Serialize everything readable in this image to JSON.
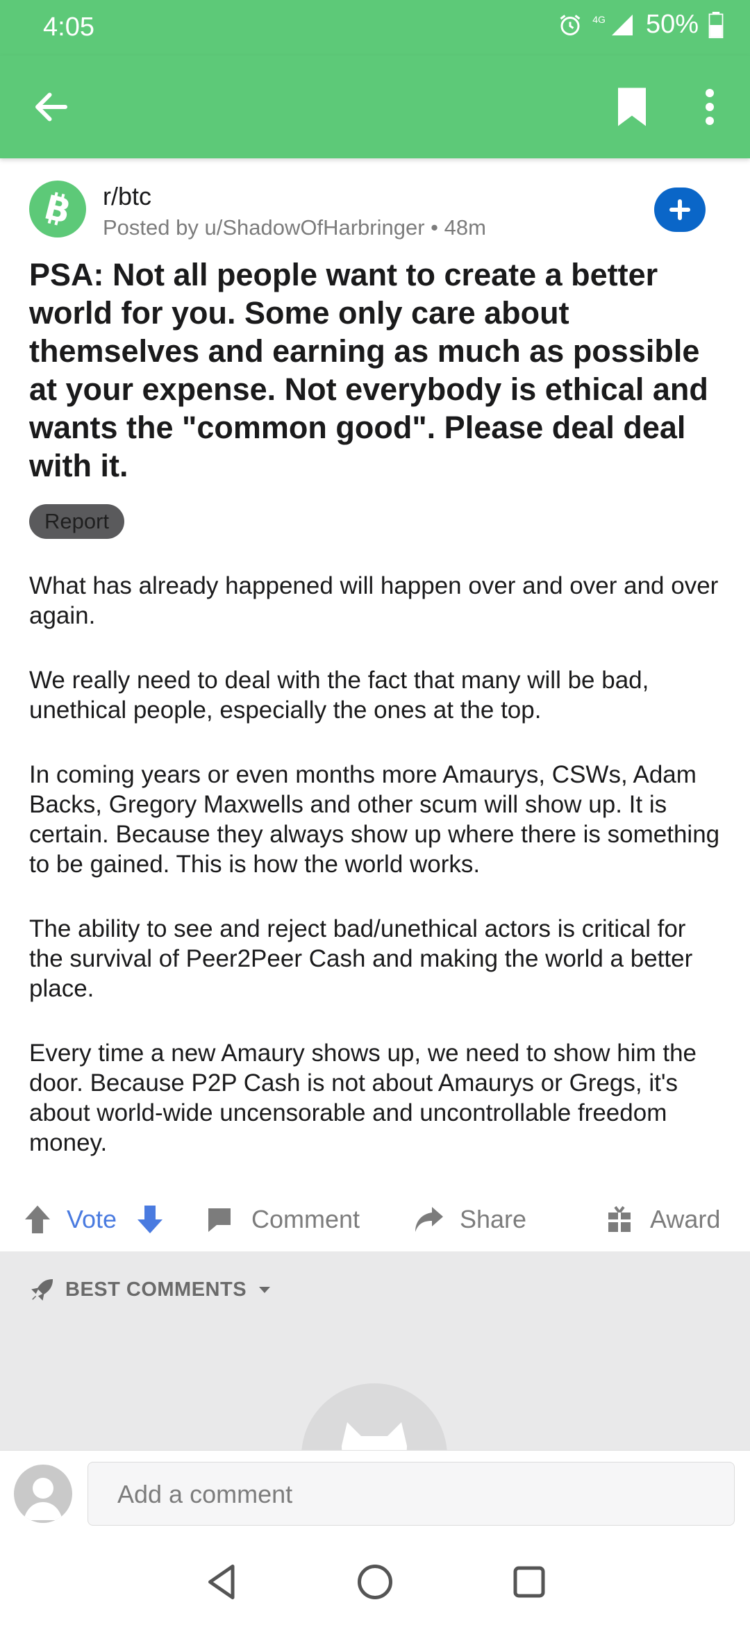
{
  "status": {
    "time": "4:05",
    "network": "4G",
    "battery": "50%"
  },
  "appbar": {
    "back_icon": "arrow-left-icon",
    "bookmark_icon": "bookmark-icon",
    "more_icon": "more-vert-icon"
  },
  "post": {
    "subreddit": "r/btc",
    "meta": "Posted by u/ShadowOfHarbringer • 48m",
    "title": "PSA: Not all people want to create a better world for you. Some only care about themselves and earning as much as possible at your expense. Not everybody is ethical and wants the \"common good\". Please deal deal with it.",
    "flair": "Report",
    "paragraphs": [
      "What has already happened will happen over and over and over again.",
      "We really need to deal with the fact that many will be bad, unethical people, especially the ones at the top.",
      "In coming years or even months more Amaurys, CSWs, Adam Backs, Gregory Maxwells and other scum will show up. It is certain. Because they always show up where there is something to be gained. This is how the world works.",
      "The ability to see and reject bad/unethical actors is critical for the survival of Peer2Peer Cash and making the world a better place.",
      "Every time a new Amaury shows up, we need to show him the door. Because P2P Cash is not about Amaurys or Gregs, it's about world-wide uncensorable and uncontrollable freedom money."
    ]
  },
  "actions": {
    "vote": "Vote",
    "comment": "Comment",
    "share": "Share",
    "award": "Award"
  },
  "comments": {
    "sort_label": "BEST COMMENTS"
  },
  "composer": {
    "placeholder": "Add a comment"
  },
  "colors": {
    "appbar": "#5dc978",
    "accent_blue": "#0a66c8",
    "vote_blue": "#4a7be0"
  }
}
